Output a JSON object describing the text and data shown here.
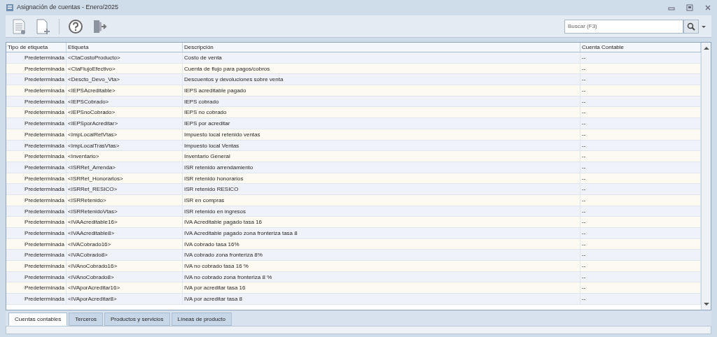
{
  "window": {
    "title": "Asignación de cuentas - Enero/2025"
  },
  "search": {
    "placeholder": "Buscar (F3)"
  },
  "table": {
    "columns": [
      "Tipo de etiqueta",
      "Etiqueta",
      "Descripción",
      "Cuenta Contable"
    ],
    "rows": [
      [
        "Predeterminada",
        "<CtaCostoProducto>",
        "Costo de venta",
        "--"
      ],
      [
        "Predeterminada",
        "<CtaFlujoEfectivo>",
        "Cuenta de flujo para pagos/cobros",
        "--"
      ],
      [
        "Predeterminada",
        "<Descto_Devo_Vta>",
        "Descuentos y devoluciones sobre venta",
        "--"
      ],
      [
        "Predeterminada",
        "<IEPSAcreditable>",
        "IEPS acreditable pagado",
        "--"
      ],
      [
        "Predeterminada",
        "<IEPSCobrado>",
        "IEPS cobrado",
        "--"
      ],
      [
        "Predeterminada",
        "<IEPSnoCobrado>",
        "IEPS no cobrado",
        "--"
      ],
      [
        "Predeterminada",
        "<IEPSporAcreditar>",
        "IEPS por acreditar",
        "--"
      ],
      [
        "Predeterminada",
        "<ImpLocalRetVtas>",
        "Impuesto local retenido ventas",
        "--"
      ],
      [
        "Predeterminada",
        "<ImpLocalTrasVtas>",
        "Impuesto local Ventas",
        "--"
      ],
      [
        "Predeterminada",
        "<Inventario>",
        "Inventario General",
        "--"
      ],
      [
        "Predeterminada",
        "<ISRRet_Arrenda>",
        "ISR retenido arrendamiento",
        "--"
      ],
      [
        "Predeterminada",
        "<ISRRet_Honorarios>",
        "ISR retenido honorarios",
        "--"
      ],
      [
        "Predeterminada",
        "<ISRRet_RESICO>",
        "ISR retenido RESICO",
        "--"
      ],
      [
        "Predeterminada",
        "<ISRRetenido>",
        "ISR en compras",
        "--"
      ],
      [
        "Predeterminada",
        "<ISRRetenidoVtas>",
        "ISR retenido en ingresos",
        "--"
      ],
      [
        "Predeterminada",
        "<IVAAcreditable16>",
        "IVA Acreditable pagado tasa 16",
        "--"
      ],
      [
        "Predeterminada",
        "<IVAAcreditable8>",
        "IVA Acreditable pagado zona fronteriza tasa 8",
        "--"
      ],
      [
        "Predeterminada",
        "<IVACobrado16>",
        "IVA cobrado tasa 16%",
        "--"
      ],
      [
        "Predeterminada",
        "<IVACobrado8>",
        "IVA cobrado zona fronteriza 8%",
        "--"
      ],
      [
        "Predeterminada",
        "<IVAnoCobrado16>",
        "IVA no cobrado tasa 16 %",
        "--"
      ],
      [
        "Predeterminada",
        "<IVAnoCobrado8>",
        "IVA no cobrado zona fronteriza 8 %",
        "--"
      ],
      [
        "Predeterminada",
        "<IVAporAcreditar16>",
        "IVA por acreditar tasa 16",
        "--"
      ],
      [
        "Predeterminada",
        "<IVAporAcreditar8>",
        "IVA por acreditar tasa 8",
        "--"
      ]
    ]
  },
  "tabs": [
    {
      "label": "Cuentas contables",
      "selected": true
    },
    {
      "label": "Terceros",
      "selected": false
    },
    {
      "label": "Productos y servicios",
      "selected": false
    },
    {
      "label": "Líneas de producto",
      "selected": false
    }
  ]
}
